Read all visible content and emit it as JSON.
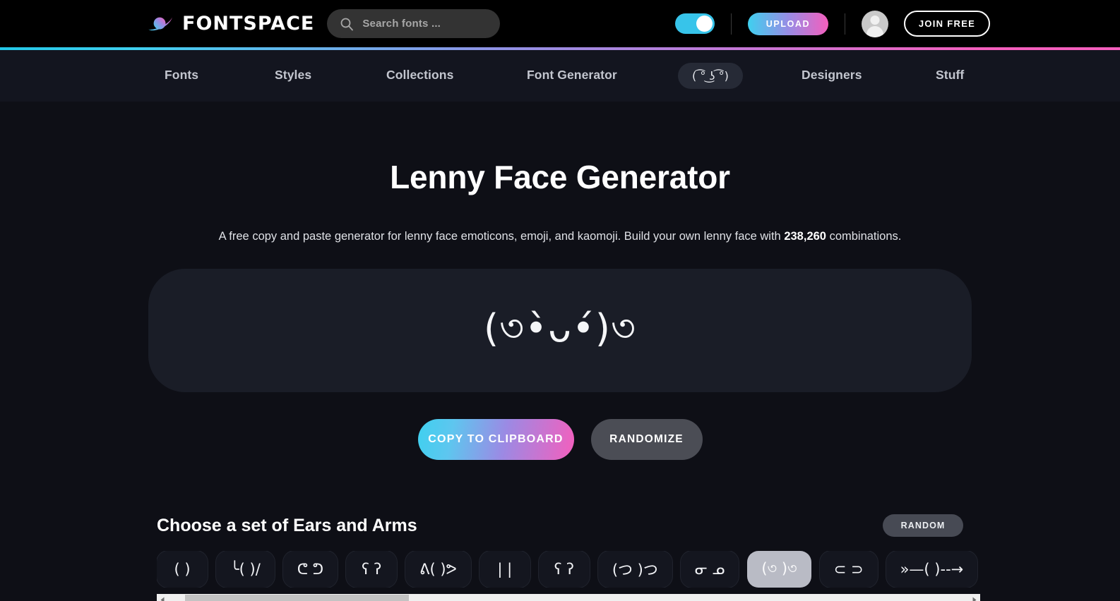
{
  "header": {
    "brand_name": "FONTSPACE",
    "search": {
      "placeholder": "Search fonts ..."
    },
    "theme_toggle_label": "dark-mode-toggle",
    "upload_label": "UPLOAD",
    "join_label": "JOIN FREE",
    "accent_cyan": "#3fd0ef",
    "accent_pink": "#f45fbd"
  },
  "nav": {
    "items": [
      {
        "label": "Fonts",
        "active": false
      },
      {
        "label": "Styles",
        "active": false
      },
      {
        "label": "Collections",
        "active": false
      },
      {
        "label": "Font Generator",
        "active": false
      },
      {
        "label": "( ͡° ͜ʖ ͡°)",
        "active": true
      },
      {
        "label": "Designers",
        "active": false
      },
      {
        "label": "Stuff",
        "active": false
      }
    ]
  },
  "main": {
    "title": "Lenny Face Generator",
    "description_before": "A free copy and paste generator for lenny face emoticons, emoji, and kaomoji. Build your own lenny face with ",
    "description_count": "238,260",
    "description_after": " combinations.",
    "current_face": "(৩•̀ᴗ•́)৩",
    "copy_label": "COPY TO CLIPBOARD",
    "randomize_label": "RANDOMIZE"
  },
  "picker": {
    "title": "Choose a set of Ears and Arms",
    "random_label": "RANDOM",
    "options": [
      {
        "glyph": "( )",
        "selected": false
      },
      {
        "glyph": "╰( )/",
        "selected": false
      },
      {
        "glyph": "ᕦ ᕤ",
        "selected": false
      },
      {
        "glyph": "ʕ ʔ",
        "selected": false
      },
      {
        "glyph": "ᕕ( )ᕗ",
        "selected": false
      },
      {
        "glyph": "| |",
        "selected": false
      },
      {
        "glyph": "ʕ ʔ",
        "selected": false
      },
      {
        "glyph": "(つ )つ",
        "selected": false
      },
      {
        "glyph": "ᓂ ᓄ",
        "selected": false
      },
      {
        "glyph": "(৩ )৩",
        "selected": true
      },
      {
        "glyph": "⊂ ⊃",
        "selected": false
      },
      {
        "glyph": "»—( )--→",
        "selected": false
      }
    ],
    "scroll": {
      "position_percent": 2,
      "thumb_percent": 28
    }
  }
}
